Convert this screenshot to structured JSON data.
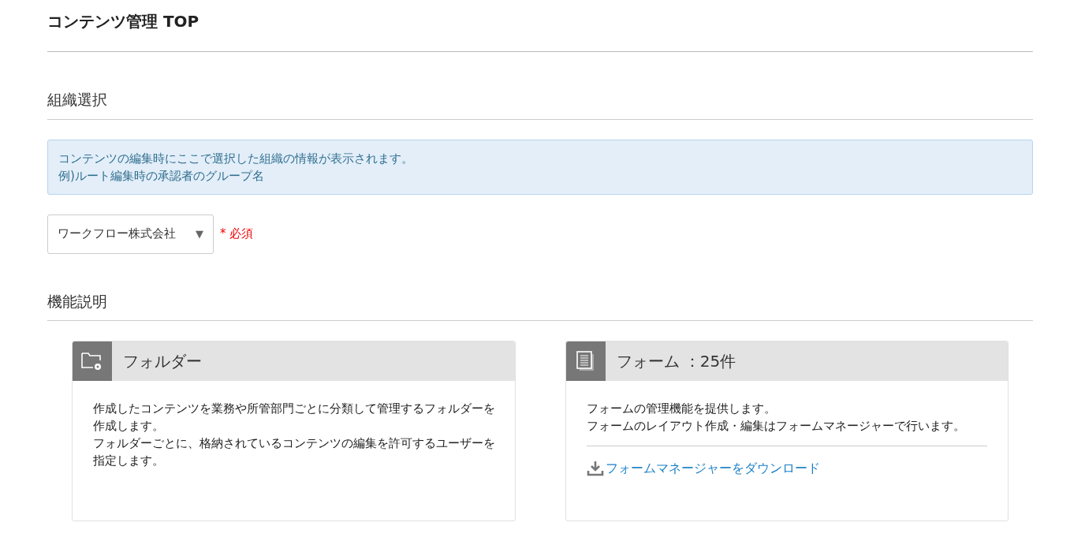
{
  "page_title": "コンテンツ管理 TOP",
  "org_section": {
    "heading": "組織選択",
    "info": [
      "コンテンツの編集時にここで選択した組織の情報が表示されます。",
      "例)ルート編集時の承認者のグループ名"
    ],
    "select": {
      "value": "ワークフロー株式会社",
      "caret": "▼"
    },
    "required_mark": "*",
    "required_label": "必須"
  },
  "features_section": {
    "heading": "機能説明",
    "cards": [
      {
        "kind": "folder",
        "title": "フォルダー",
        "description": [
          "作成したコンテンツを業務や所管部門ごとに分類して管理するフォルダーを作成します。",
          "フォルダーごとに、格納されているコンテンツの編集を許可するユーザーを指定します。"
        ]
      },
      {
        "kind": "form",
        "title": "フォーム ：25件",
        "description": [
          "フォームの管理機能を提供します。",
          "フォームのレイアウト作成・編集はフォームマネージャーで行います。"
        ],
        "link": "フォームマネージャーをダウンロード"
      }
    ]
  }
}
